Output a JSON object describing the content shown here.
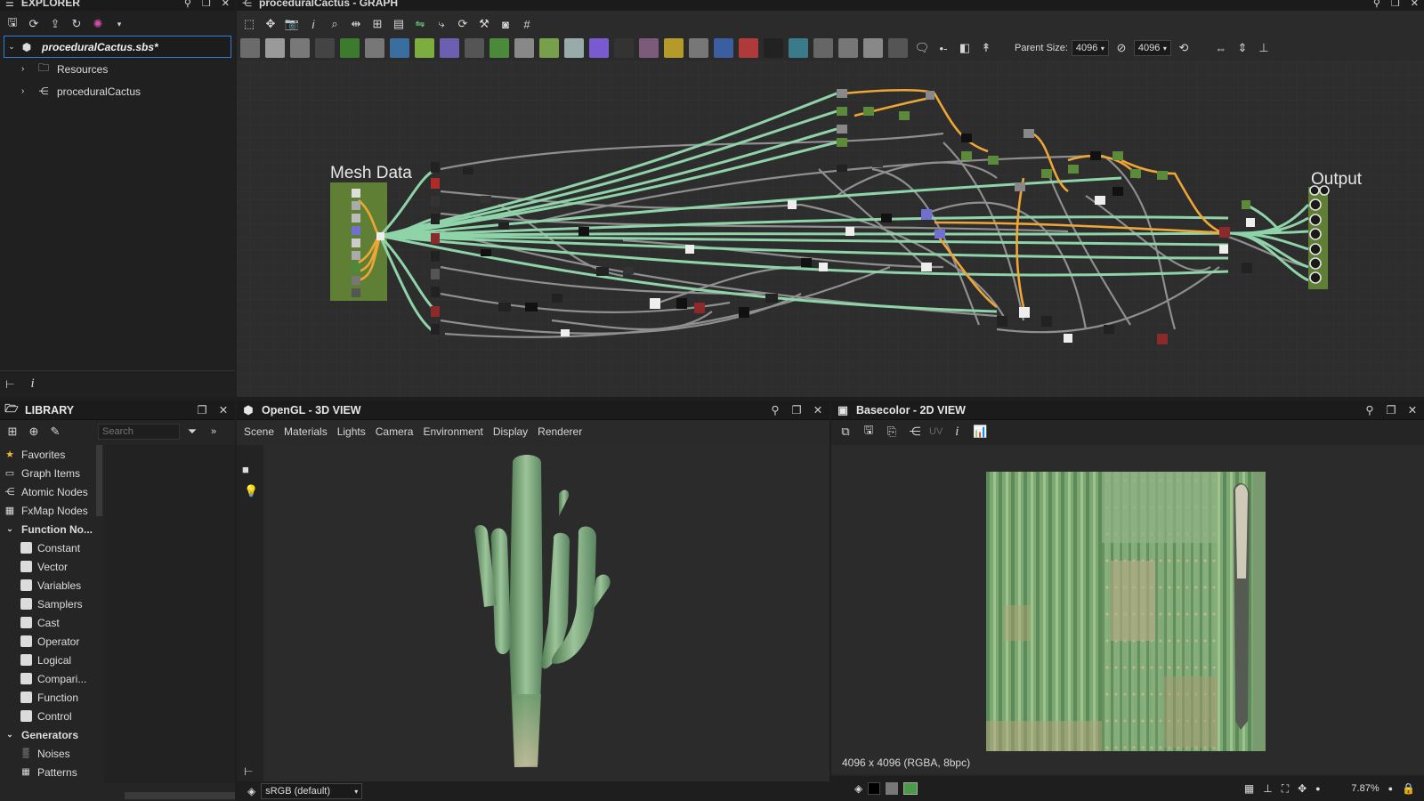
{
  "explorer": {
    "title": "EXPLORER",
    "file": "proceduralCactus.sbs*",
    "items": [
      {
        "label": "Resources"
      },
      {
        "label": "proceduralCactus"
      }
    ]
  },
  "graph": {
    "title": "proceduralCactus - GRAPH",
    "parent_size_label": "Parent Size:",
    "width_value": "4096",
    "height_value": "4096",
    "frame_mesh_label": "Mesh Data",
    "frame_output_label": "Output"
  },
  "library": {
    "title": "LIBRARY",
    "search_placeholder": "Search",
    "items": [
      {
        "label": "Favorites"
      },
      {
        "label": "Graph Items"
      },
      {
        "label": "Atomic Nodes"
      },
      {
        "label": "FxMap Nodes"
      },
      {
        "label": "Function No..."
      },
      {
        "label": "Constant"
      },
      {
        "label": "Vector"
      },
      {
        "label": "Variables"
      },
      {
        "label": "Samplers"
      },
      {
        "label": "Cast"
      },
      {
        "label": "Operator"
      },
      {
        "label": "Logical"
      },
      {
        "label": "Compari..."
      },
      {
        "label": "Function"
      },
      {
        "label": "Control"
      },
      {
        "label": "Generators"
      },
      {
        "label": "Noises"
      },
      {
        "label": "Patterns"
      }
    ]
  },
  "view3d": {
    "title": "OpenGL - 3D VIEW",
    "menu": [
      "Scene",
      "Materials",
      "Lights",
      "Camera",
      "Environment",
      "Display",
      "Renderer"
    ],
    "colorspace": "sRGB (default)"
  },
  "view2d": {
    "title": "Basecolor - 2D VIEW",
    "uv_label": "UV",
    "info": "4096 x 4096 (RGBA, 8bpc)",
    "zoom": "7.87%"
  },
  "colors": {
    "accent_frame": "#5f7f34",
    "wire_green": "#8fd3a9",
    "wire_orange": "#f0a636",
    "wire_grey": "#9a9a9a",
    "selected_border": "#2f7fd8"
  }
}
